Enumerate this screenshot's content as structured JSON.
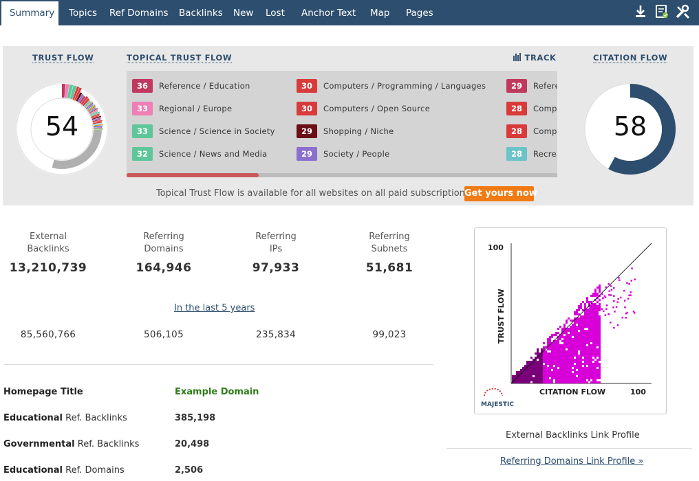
{
  "nav": {
    "tabs": [
      "Summary",
      "Topics",
      "Ref Domains",
      "Backlinks",
      "New",
      "Lost",
      "Anchor Text",
      "Map",
      "Pages"
    ],
    "icons": [
      "download-icon",
      "report-icon",
      "tools-icon"
    ]
  },
  "trust_flow": {
    "title": "TRUST FLOW",
    "value": "54"
  },
  "citation_flow": {
    "title": "CITATION FLOW",
    "value": "58"
  },
  "topical": {
    "title": "TOPICAL TRUST FLOW",
    "track_label": "TRACK",
    "topics": [
      {
        "score": "36",
        "label": "Reference / Education",
        "color": "#c0395e"
      },
      {
        "score": "33",
        "label": "Regional / Europe",
        "color": "#ef7fb4"
      },
      {
        "score": "33",
        "label": "Science / Science in Society",
        "color": "#5ec79a"
      },
      {
        "score": "32",
        "label": "Science / News and Media",
        "color": "#5ec79a"
      },
      {
        "score": "30",
        "label": "Computers / Programming / Languages",
        "color": "#d93a3a"
      },
      {
        "score": "30",
        "label": "Computers / Open Source",
        "color": "#d93a3a"
      },
      {
        "score": "29",
        "label": "Shopping / Niche",
        "color": "#6b0f17"
      },
      {
        "score": "29",
        "label": "Society / People",
        "color": "#8b6fd0"
      },
      {
        "score": "29",
        "label": "Refere",
        "color": "#c0395e"
      },
      {
        "score": "28",
        "label": "Compu",
        "color": "#d93a3a"
      },
      {
        "score": "28",
        "label": "Compu",
        "color": "#d93a3a"
      },
      {
        "score": "28",
        "label": "Recrea",
        "color": "#6cc3c8"
      }
    ],
    "availability_text": "Topical Trust Flow is available for all websites on all paid subscriptions",
    "cta_label": "Get yours now"
  },
  "stats": [
    {
      "label_line1": "External",
      "label_line2": "Backlinks",
      "value": "13,210,739",
      "historic": "85,560,766"
    },
    {
      "label_line1": "Referring",
      "label_line2": "Domains",
      "value": "164,946",
      "historic": "506,105"
    },
    {
      "label_line1": "Referring",
      "label_line2": "IPs",
      "value": "97,933",
      "historic": "235,834"
    },
    {
      "label_line1": "Referring",
      "label_line2": "Subnets",
      "value": "51,681",
      "historic": "99,023"
    }
  ],
  "last5_link": "In the last 5 years",
  "info_rows": [
    {
      "bold": "Homepage Title",
      "rest": "",
      "value": "Example Domain"
    },
    {
      "bold": "Educational",
      "rest": " Ref. Backlinks",
      "value": "385,198"
    },
    {
      "bold": "Governmental",
      "rest": " Ref. Backlinks",
      "value": "20,498"
    },
    {
      "bold": "Educational",
      "rest": " Ref. Domains",
      "value": "2,506"
    }
  ],
  "chart_data": {
    "type": "scatter",
    "x_label": "CITATION FLOW",
    "y_label": "TRUST FLOW",
    "x_max_label": "100",
    "y_max_label": "100",
    "xlim": [
      0,
      100
    ],
    "ylim": [
      0,
      100
    ],
    "color": "#d800d8",
    "logo_text": "MAJESTIC"
  },
  "chart_caption": "External Backlinks Link Profile",
  "chart_link": "Referring Domains Link Profile »"
}
